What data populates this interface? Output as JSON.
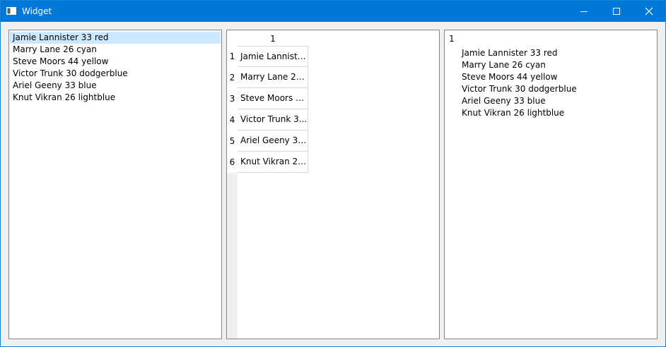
{
  "window": {
    "title": "Widget"
  },
  "list_view": {
    "items": [
      "Jamie Lannister 33 red",
      "Marry Lane 26 cyan",
      "Steve Moors 44 yellow",
      "Victor Trunk 30 dodgerblue",
      "Ariel Geeny 33 blue",
      "Knut Vikran 26 lightblue"
    ],
    "selected_index": 0
  },
  "table_view": {
    "column_header": "1",
    "row_headers": [
      "1",
      "2",
      "3",
      "4",
      "5",
      "6"
    ],
    "cells": [
      "Jamie Lannister...",
      "Marry Lane 26 ...",
      "Steve Moors 4...",
      "Victor Trunk 3...",
      "Ariel Geeny 33 ...",
      "Knut Vikran 26..."
    ]
  },
  "tree_view": {
    "header": "1",
    "items": [
      "Jamie Lannister 33 red",
      "Marry Lane 26 cyan",
      "Steve Moors 44 yellow",
      "Victor Trunk 30 dodgerblue",
      "Ariel Geeny 33 blue",
      "Knut Vikran 26 lightblue"
    ]
  },
  "colors": {
    "titlebar": "#0078d7",
    "selection": "#cce8ff"
  }
}
